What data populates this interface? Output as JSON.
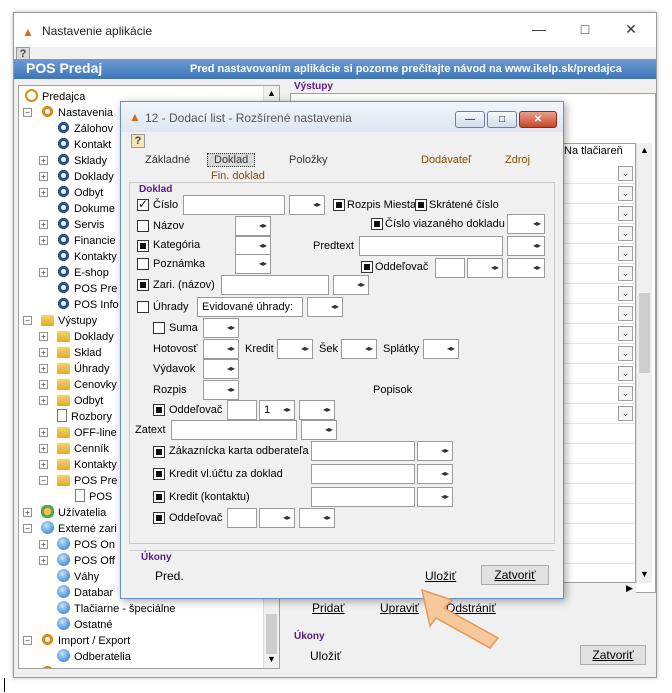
{
  "window": {
    "title": "Nastavenie aplikácie",
    "header_title": "POS Predaj",
    "header_hint": "Pred nastavovaním aplikácie si pozorne prečítajte návod na www.ikelp.sk/predajca",
    "help_glyph": "?"
  },
  "tree": [
    {
      "label": "Predajca",
      "icon": "chain-icon",
      "level": 0,
      "pm": ""
    },
    {
      "label": "Nastavenia",
      "icon": "gear-orange-icon",
      "level": 1,
      "pm": "−"
    },
    {
      "label": "Zálohov",
      "icon": "gear-icon",
      "level": 2,
      "pm": ""
    },
    {
      "label": "Kontakt",
      "icon": "gear-icon",
      "level": 2,
      "pm": ""
    },
    {
      "label": "Sklady",
      "icon": "gear-icon",
      "level": 2,
      "pm": "+"
    },
    {
      "label": "Doklady",
      "icon": "gear-icon",
      "level": 2,
      "pm": "+"
    },
    {
      "label": "Odbyt",
      "icon": "gear-icon",
      "level": 2,
      "pm": "+"
    },
    {
      "label": "Dokume",
      "icon": "gear-icon",
      "level": 2,
      "pm": ""
    },
    {
      "label": "Servis",
      "icon": "gear-icon",
      "level": 2,
      "pm": "+"
    },
    {
      "label": "Financie",
      "icon": "gear-icon",
      "level": 2,
      "pm": "+"
    },
    {
      "label": "Kontakty",
      "icon": "gear-icon",
      "level": 2,
      "pm": ""
    },
    {
      "label": "E-shop",
      "icon": "gear-icon",
      "level": 2,
      "pm": "+"
    },
    {
      "label": "POS Pre",
      "icon": "gear-icon",
      "level": 2,
      "pm": ""
    },
    {
      "label": "POS Info",
      "icon": "gear-icon",
      "level": 2,
      "pm": ""
    },
    {
      "label": "Výstupy",
      "icon": "folder-icon",
      "level": 1,
      "pm": "−"
    },
    {
      "label": "Doklady",
      "icon": "folder-icon",
      "level": 2,
      "pm": "+"
    },
    {
      "label": "Sklad",
      "icon": "folder-icon",
      "level": 2,
      "pm": "+"
    },
    {
      "label": "Úhrady",
      "icon": "folder-icon",
      "level": 2,
      "pm": "+"
    },
    {
      "label": "Cenovky",
      "icon": "folder-icon",
      "level": 2,
      "pm": "+"
    },
    {
      "label": "Odbyt",
      "icon": "folder-icon",
      "level": 2,
      "pm": "+"
    },
    {
      "label": "Rozbory",
      "icon": "document-icon",
      "level": 2,
      "pm": ""
    },
    {
      "label": "OFF-line",
      "icon": "folder-icon",
      "level": 2,
      "pm": "+"
    },
    {
      "label": "Cenník",
      "icon": "folder-icon",
      "level": 2,
      "pm": "+"
    },
    {
      "label": "Kontakty",
      "icon": "folder-icon",
      "level": 2,
      "pm": "+"
    },
    {
      "label": "POS Pre",
      "icon": "folder-icon",
      "level": 2,
      "pm": "−"
    },
    {
      "label": "POS",
      "icon": "document-icon",
      "level": 3,
      "pm": ""
    },
    {
      "label": "Užívatelia",
      "icon": "people-icon",
      "level": 1,
      "pm": "+"
    },
    {
      "label": "Externé zari",
      "icon": "globe-icon",
      "level": 1,
      "pm": "−"
    },
    {
      "label": "POS On",
      "icon": "globe-icon",
      "level": 2,
      "pm": "+"
    },
    {
      "label": "POS Off",
      "icon": "globe-icon",
      "level": 2,
      "pm": "+"
    },
    {
      "label": "Váhy",
      "icon": "globe-icon",
      "level": 2,
      "pm": ""
    },
    {
      "label": "Databar",
      "icon": "globe-icon",
      "level": 2,
      "pm": ""
    },
    {
      "label": "Tlačiarne - špeciálne",
      "icon": "globe-icon",
      "level": 2,
      "pm": ""
    },
    {
      "label": "Ostatné",
      "icon": "globe-icon",
      "level": 2,
      "pm": ""
    },
    {
      "label": "Import / Export",
      "icon": "gear-orange-icon",
      "level": 1,
      "pm": "−"
    },
    {
      "label": "Odberatelia",
      "icon": "globe-icon",
      "level": 2,
      "pm": ""
    },
    {
      "label": "Rozšírenie",
      "icon": "gear-orange-icon",
      "level": 1,
      "pm": ""
    }
  ],
  "right": {
    "vystupy_title": "Výstupy",
    "col_header": "Na tlačiareň",
    "row_count": 20,
    "bottom_buttons": [
      "Pridať",
      "Upraviť",
      "Odstrániť"
    ],
    "ukony_title": "Úkony",
    "ulozit": "Uložiť",
    "zatvorit": "Zatvoriť"
  },
  "dialog": {
    "title": "12 - Dodací list - Rozšírené nastavenia",
    "tabs": [
      "Základné",
      "Doklad",
      "Položky",
      "Dodávateľ",
      "Zdroj"
    ],
    "subtab": "Fin. doklad",
    "group_title": "Doklad",
    "labels": {
      "cislo": "Číslo",
      "nazov": "Názov",
      "kategoria": "Kategória",
      "poznamka": "Poznámka",
      "zari": "Zari. (názov)",
      "uhrady": "Úhrady",
      "evidovane": "Evidované úhrady:",
      "suma": "Suma",
      "hotovost": "Hotovosť",
      "kredit": "Kredit",
      "sek": "Šek",
      "splatky": "Splátky",
      "vydavok": "Výdavok",
      "rozpis": "Rozpis",
      "oddelovac": "Oddeľovač",
      "zatext": "Zatext",
      "zakaznicka": "Zákaznícka karta odberateľa",
      "kredit_uctu": "Kredit vl.účtu za doklad",
      "kredit_kontaktu": "Kredit (kontaktu)",
      "rozpis_miesta": "Rozpis Miesta",
      "skratene": "Skrátené číslo",
      "cislo_viazaneho": "Číslo viazaného dokladu",
      "predtext": "Predtext",
      "popisok": "Popisok",
      "oddelovac_count": "1"
    },
    "ukony_title": "Úkony",
    "pred": "Pred.",
    "ulozit": "Uložiť",
    "zatvorit": "Zatvoriť"
  }
}
